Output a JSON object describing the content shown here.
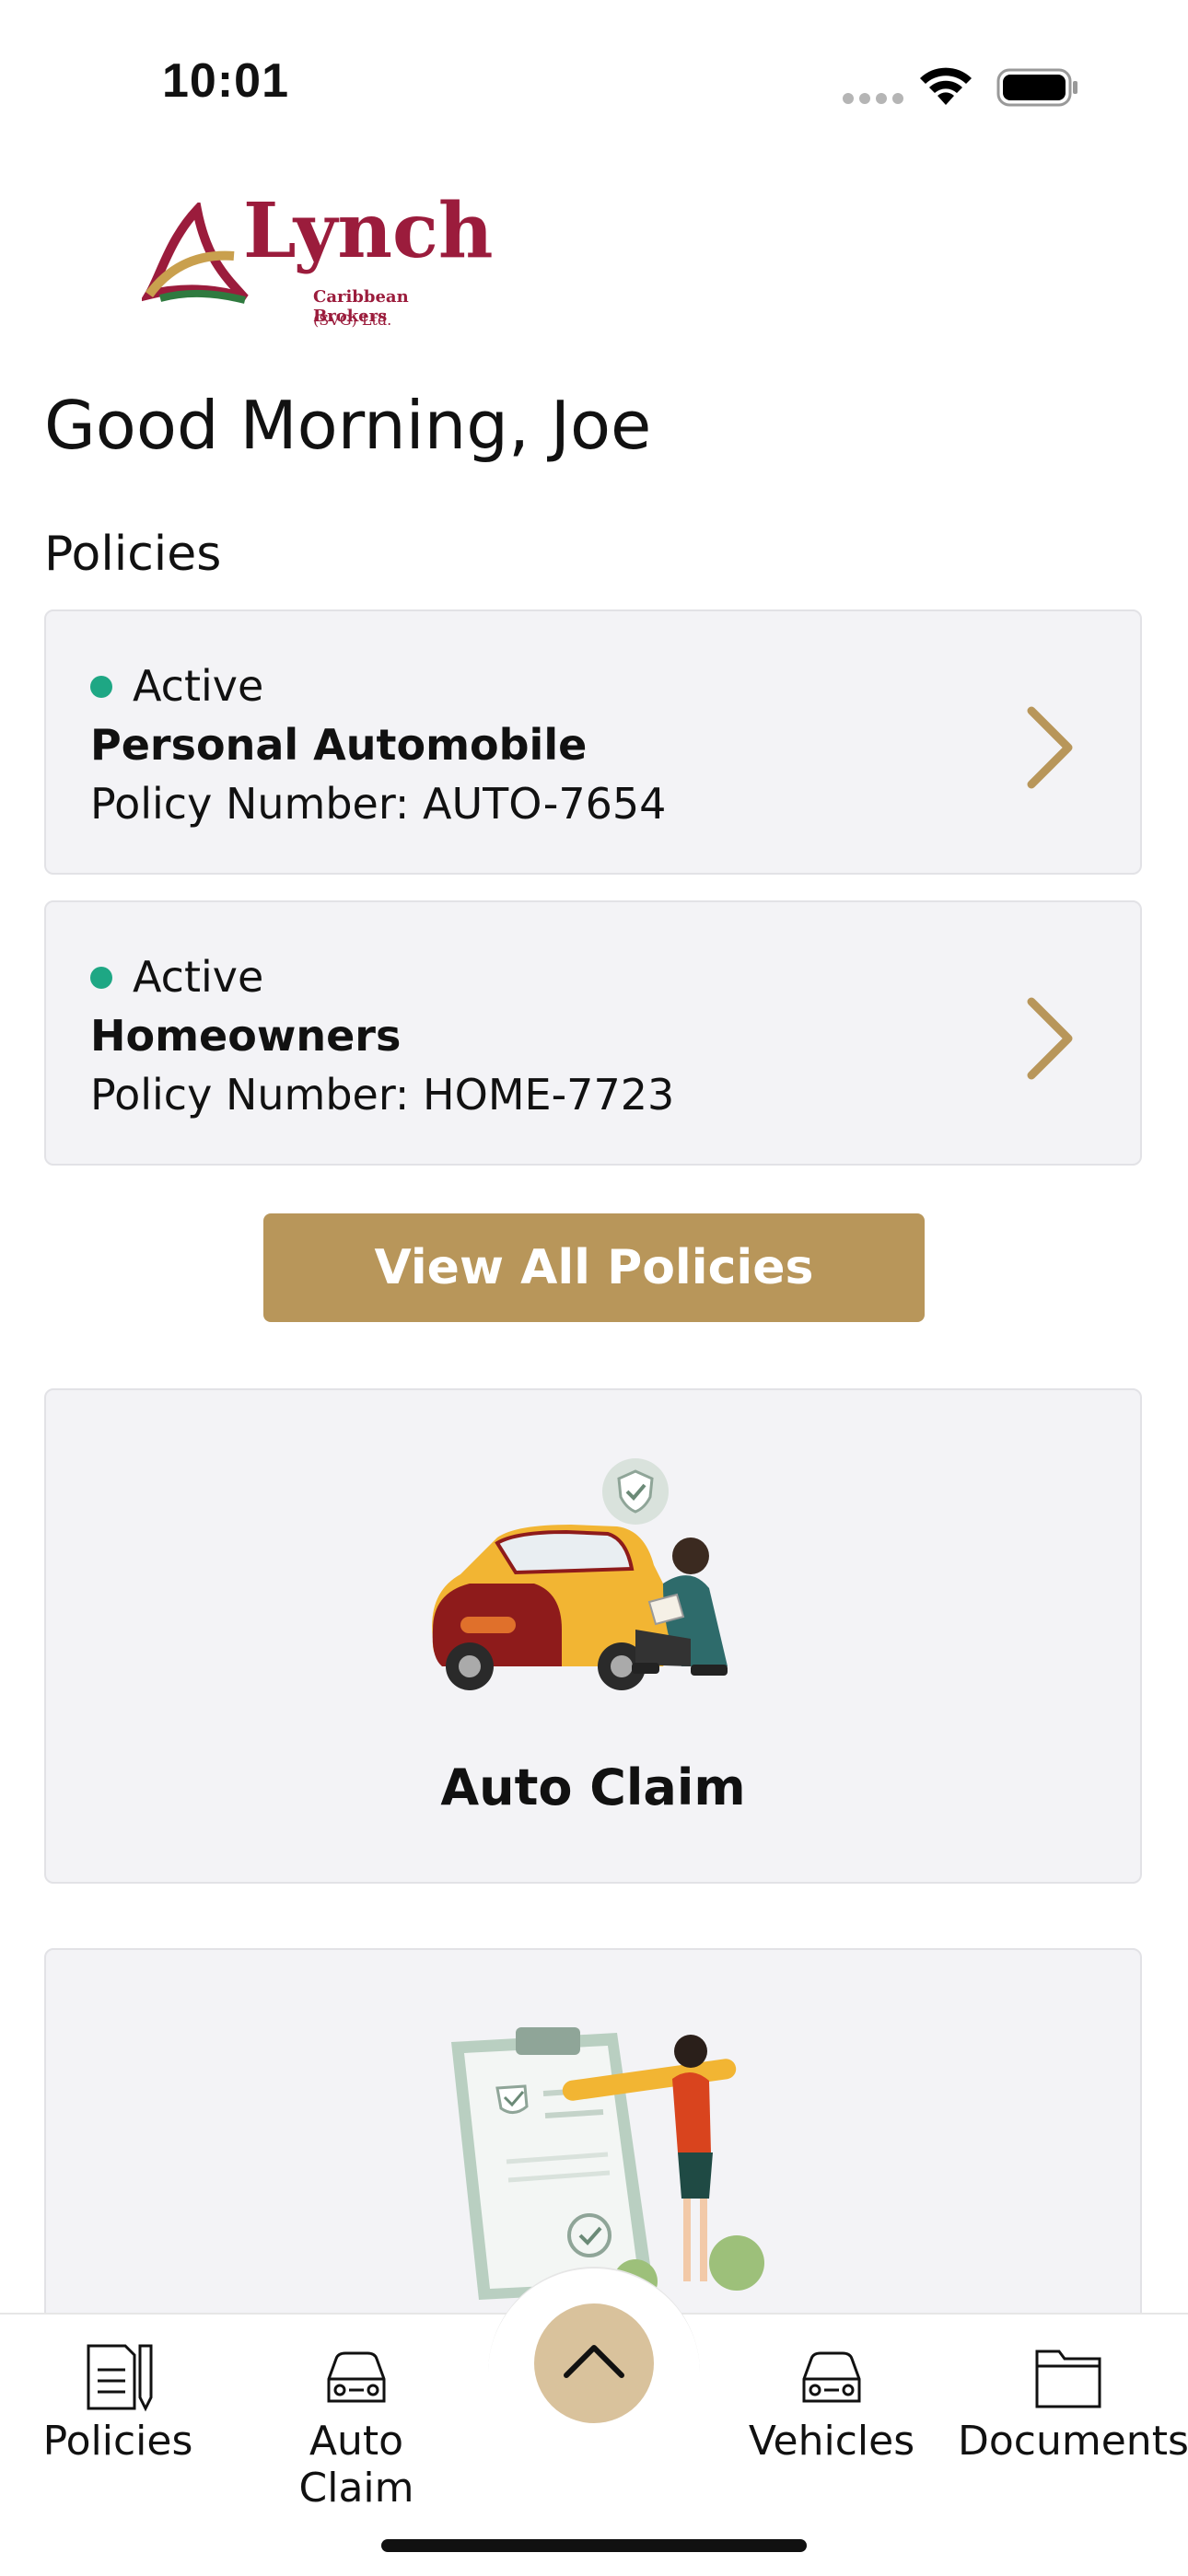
{
  "status_bar": {
    "time": "10:01"
  },
  "logo": {
    "name": "Lynch",
    "line1": "Caribbean Brokers",
    "line2": "(SVG) Ltd.",
    "brand_color": "#9b1c3c",
    "accent_gold": "#c9a04e",
    "accent_green": "#2f7a3f"
  },
  "greeting": "Good Morning, Joe",
  "policies_section": {
    "title": "Policies",
    "items": [
      {
        "status": "Active",
        "type": "Personal Automobile",
        "number": "Policy Number: AUTO-7654"
      },
      {
        "status": "Active",
        "type": "Homeowners",
        "number": "Policy Number: HOME-7723"
      }
    ],
    "view_all_label": "View All Policies"
  },
  "cards": [
    {
      "title": "Auto Claim",
      "illustration": "car-accident-illustration"
    },
    {
      "title": "",
      "illustration": "clipboard-checklist-illustration"
    }
  ],
  "bottom_nav": {
    "items": [
      {
        "label": "Policies",
        "icon": "document-pencil-icon"
      },
      {
        "label": "Auto Claim",
        "icon": "car-icon"
      },
      {
        "label": "Vehicles",
        "icon": "car-icon"
      },
      {
        "label": "Documents",
        "icon": "folder-icon"
      }
    ],
    "center_icon": "chevron-up-icon"
  },
  "colors": {
    "active_dot": "#1ea784",
    "primary_button": "#b8965a",
    "chevron": "#b8965a",
    "card_bg": "#f3f3f6",
    "center_button": "#d9c29c"
  }
}
